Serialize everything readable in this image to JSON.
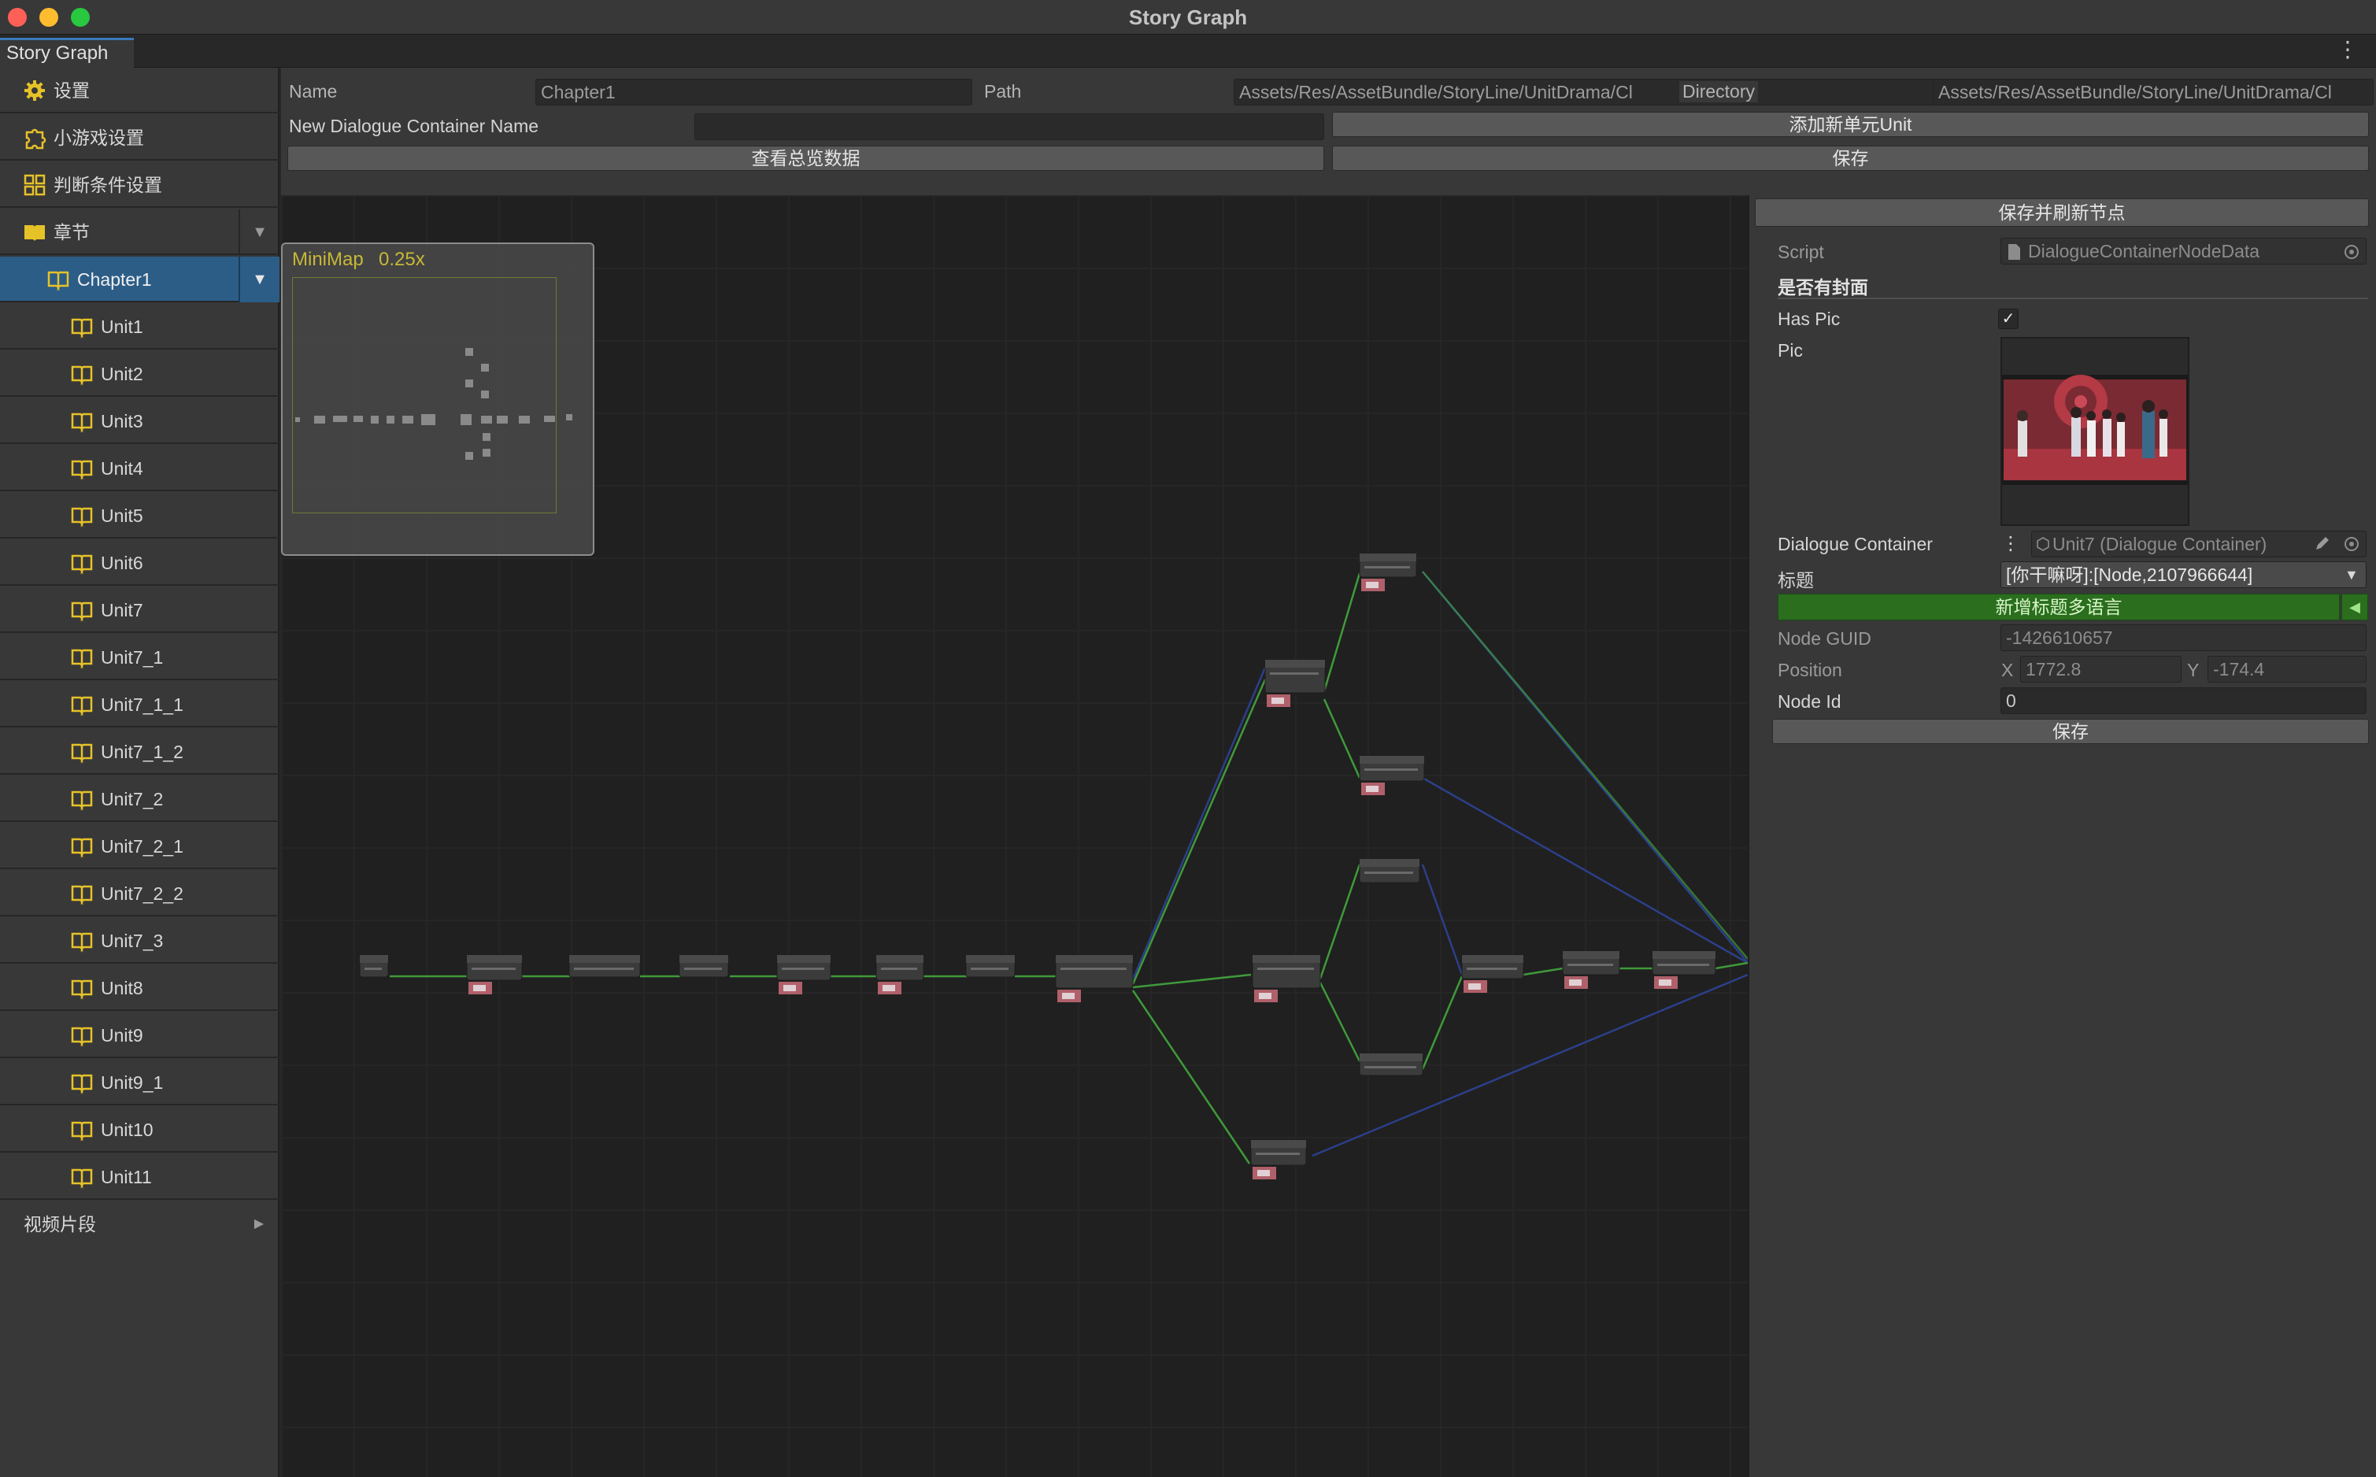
{
  "window": {
    "title": "Story Graph"
  },
  "tabbar": {
    "tab_label": "Story Graph"
  },
  "sidebar": {
    "settings": "设置",
    "minigame": "小游戏设置",
    "conditions": "判断条件设置",
    "chapters": "章节",
    "chapter1": "Chapter1",
    "units": [
      "Unit1",
      "Unit2",
      "Unit3",
      "Unit4",
      "Unit5",
      "Unit6",
      "Unit7",
      "Unit7_1",
      "Unit7_1_1",
      "Unit7_1_2",
      "Unit7_2",
      "Unit7_2_1",
      "Unit7_2_2",
      "Unit7_3",
      "Unit8",
      "Unit9",
      "Unit9_1",
      "Unit10",
      "Unit11"
    ],
    "video": "视频片段",
    "colors": {
      "selected": "#2c5d87",
      "icon_yellow": "#e6c229"
    }
  },
  "toolbar": {
    "name_label": "Name",
    "name_value": "Chapter1",
    "path_label": "Path",
    "path_value": "Assets/Res/AssetBundle/StoryLine/UnitDrama/Cl",
    "directory_label": "Directory",
    "directory_value": "Assets/Res/AssetBundle/StoryLine/UnitDrama/Cl",
    "new_container_label": "New Dialogue Container Name",
    "new_container_value": "",
    "add_unit": "添加新单元Unit",
    "view_overview": "查看总览数据",
    "save": "保存"
  },
  "minimap": {
    "title": "MiniMap",
    "zoom": "0.25x"
  },
  "inspector": {
    "save_refresh": "保存并刷新节点",
    "script_label": "Script",
    "script_value": "DialogueContainerNodeData",
    "cover_header": "是否有封面",
    "has_pic_label": "Has Pic",
    "has_pic_checked": true,
    "checkmark": "✓",
    "pic_label": "Pic",
    "dialogue_container_label": "Dialogue Container",
    "dialogue_container_value": "Unit7 (Dialogue Container)",
    "title_label": "标题",
    "title_value": "[你干嘛呀]:[Node,2107966644]",
    "add_title_lang": "新增标题多语言",
    "node_guid_label": "Node GUID",
    "node_guid_value": "-1426610657",
    "position_label": "Position",
    "pos_x_label": "X",
    "pos_x_value": "1772.8",
    "pos_y_label": "Y",
    "pos_y_value": "-174.4",
    "node_id_label": "Node Id",
    "node_id_value": "0",
    "save": "保存"
  },
  "graph": {
    "edge_green": "#3f9a3a",
    "edge_blue": "#2c3f8a",
    "node_color": "#3b3b3b"
  }
}
